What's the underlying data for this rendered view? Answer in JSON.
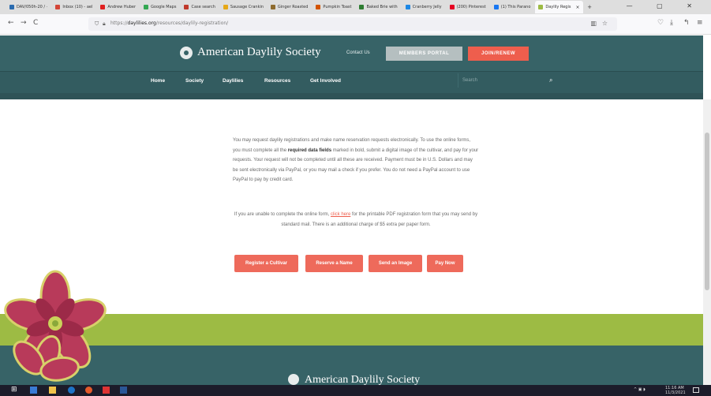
{
  "browser": {
    "tabs": [
      {
        "label": "DAV/050h-20 / ·",
        "color": "#2b6cb0"
      },
      {
        "label": "Inbox (10) - ael",
        "color": "#d44638"
      },
      {
        "label": "Andrew Huber",
        "color": "#e02020"
      },
      {
        "label": "Google Maps",
        "color": "#34a853"
      },
      {
        "label": "Case search",
        "color": "#c0392b"
      },
      {
        "label": "Sausage Crankin",
        "color": "#e6a817"
      },
      {
        "label": "Ginger Roasted",
        "color": "#8e6b2e"
      },
      {
        "label": "Pumpkin Toast",
        "color": "#d35400"
      },
      {
        "label": "Baked Brie with",
        "color": "#2e7d32"
      },
      {
        "label": "Cranberry Jelly",
        "color": "#1e88e5"
      },
      {
        "label": "(200) Pinterest",
        "color": "#e60023"
      },
      {
        "label": "(1) This Parano",
        "color": "#1877f2"
      }
    ],
    "active_tab": {
      "label": "Daylily Regis",
      "close": "×"
    },
    "new_tab": "+",
    "window_controls": "— ▢ ✕",
    "nav": {
      "back": "←",
      "forward": "→",
      "reload": "C"
    },
    "url_prefix": "https://",
    "url_domain": "daylilies.org",
    "url_path": "/resources/daylily-registration/",
    "toolbar_icons": [
      "▥",
      "☆",
      "♡",
      "⤓",
      "↰",
      "≡"
    ]
  },
  "site": {
    "title": "American Daylily Society",
    "contact": "Contact Us",
    "portal": "MEMBERS PORTAL",
    "join": "JOIN/RENEW",
    "menu": [
      "Home",
      "Society",
      "Daylilies",
      "Resources",
      "Get Involved"
    ],
    "search_placeholder": "Search",
    "search_icon": "⌕"
  },
  "content": {
    "p1_a": "You may request daylily registrations and make name reservation requests electronically. To use the online forms, you must complete all the ",
    "p1_bold": "required data fields",
    "p1_b": " marked in bold, submit a digital image of the cultivar, and pay for your requests. Your request will not be completed until all these are received. Payment must be in U.S. Dollars and may be sent electronically via PayPal, or you may mail a check if you prefer. You do not need a PayPal account to use PayPal to pay by credit card.",
    "p2_a": "If you are unable to complete the online form, ",
    "p2_link": "click here",
    "p2_b": " for the printable PDF registration form that you may send by standard mail. There is an additional charge of $5 extra per paper form."
  },
  "buttons": {
    "register": "Register a Cultivar",
    "reserve": "Reserve a Name",
    "image": "Send an Image",
    "pay": "Pay Now"
  },
  "footer": {
    "title": "American Daylily Society"
  },
  "taskbar": {
    "start": "⊞",
    "tray": "^ ▣ ◗",
    "time": "11:16 AM",
    "date": "11/3/2021"
  },
  "colors": {
    "teal": "#376367",
    "coral": "#ee5e4d",
    "green": "#9dbb44"
  }
}
